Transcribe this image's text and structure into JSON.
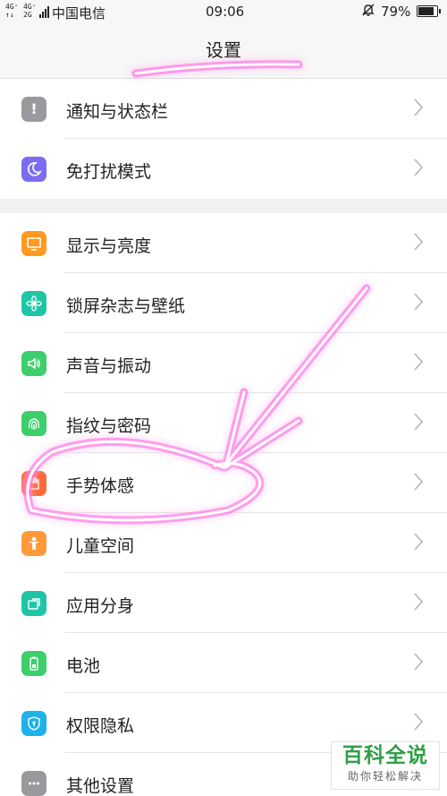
{
  "status_bar": {
    "network_1": "4G⁺",
    "network_1b": "↑↓",
    "network_2": "4G⁺",
    "network_2b": "2G",
    "carrier": "中国电信",
    "time": "09:06",
    "battery_percent": "79%",
    "battery_level": 0.79
  },
  "header": {
    "title": "设置"
  },
  "settings": {
    "group1": [
      {
        "label": "通知与状态栏",
        "icon": "notification-icon",
        "color": "#9a9a9e"
      },
      {
        "label": "免打扰模式",
        "icon": "moon-icon",
        "color": "#7b6cf0"
      }
    ],
    "group2": [
      {
        "label": "显示与亮度",
        "icon": "display-icon",
        "color": "#ff9a1f"
      },
      {
        "label": "锁屏杂志与壁纸",
        "icon": "flower-icon",
        "color": "#1fc6a5"
      },
      {
        "label": "声音与振动",
        "icon": "speaker-icon",
        "color": "#3ccf6b"
      },
      {
        "label": "指纹与密码",
        "icon": "fingerprint-icon",
        "color": "#3ccf6b"
      },
      {
        "label": "手势体感",
        "icon": "hand-gesture-icon",
        "color": "#ff6a3a"
      },
      {
        "label": "儿童空间",
        "icon": "child-icon",
        "color": "#ff9a3a"
      },
      {
        "label": "应用分身",
        "icon": "app-clone-icon",
        "color": "#1fc6a5"
      },
      {
        "label": "电池",
        "icon": "battery-icon",
        "color": "#3ccf6b"
      },
      {
        "label": "权限隐私",
        "icon": "shield-icon",
        "color": "#1fb2e8"
      },
      {
        "label": "其他设置",
        "icon": "more-icon",
        "color": "#9a9a9e"
      }
    ]
  },
  "watermark": {
    "main": "百科全说",
    "sub": "助你轻松解决"
  }
}
